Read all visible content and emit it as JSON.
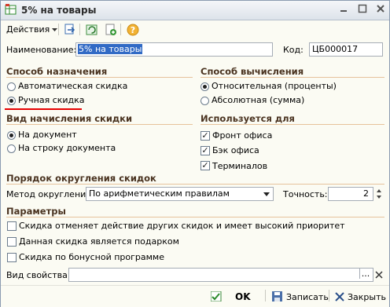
{
  "window": {
    "title": "5% на товары"
  },
  "toolbar": {
    "actions_label": "Действия"
  },
  "form": {
    "name_label": "Наименование:",
    "name_value": "5% на товары",
    "code_label": "Код:",
    "code_value": "ЦБ000017"
  },
  "assign": {
    "heading": "Способ назначения",
    "options": [
      "Автоматическая скидка",
      "Ручная скидка"
    ],
    "selected": 1
  },
  "calc": {
    "heading": "Способ вычисления",
    "options": [
      "Относительная (проценты)",
      "Абсолютная (сумма)"
    ],
    "selected": 0
  },
  "accrual": {
    "heading": "Вид начисления скидки",
    "options": [
      "На документ",
      "На строку документа"
    ],
    "selected": 0
  },
  "usedfor": {
    "heading": "Используется для",
    "items": [
      {
        "label": "Фронт офиса",
        "checked": true
      },
      {
        "label": "Бэк офиса",
        "checked": true
      },
      {
        "label": "Терминалов",
        "checked": true
      }
    ]
  },
  "rounding": {
    "heading": "Порядок округления скидок",
    "method_label": "Метод округления:",
    "method_value": "По арифметическим правилам",
    "precision_label": "Точность:",
    "precision_value": "2"
  },
  "params": {
    "heading": "Параметры",
    "items": [
      {
        "label": "Скидка отменяет действие других скидок и имеет высокий приоритет",
        "checked": false
      },
      {
        "label": "Данная скидка является подарком",
        "checked": false
      },
      {
        "label": "Скидка по бонусной программе",
        "checked": false
      }
    ],
    "prop_label": "Вид свойства:",
    "prop_value": ""
  },
  "footer": {
    "ok": "OK",
    "save": "Записать",
    "close": "Закрыть"
  },
  "colors": {
    "section_text": "#4a3320",
    "underline": "#e60000",
    "selection": "#316ac5"
  }
}
